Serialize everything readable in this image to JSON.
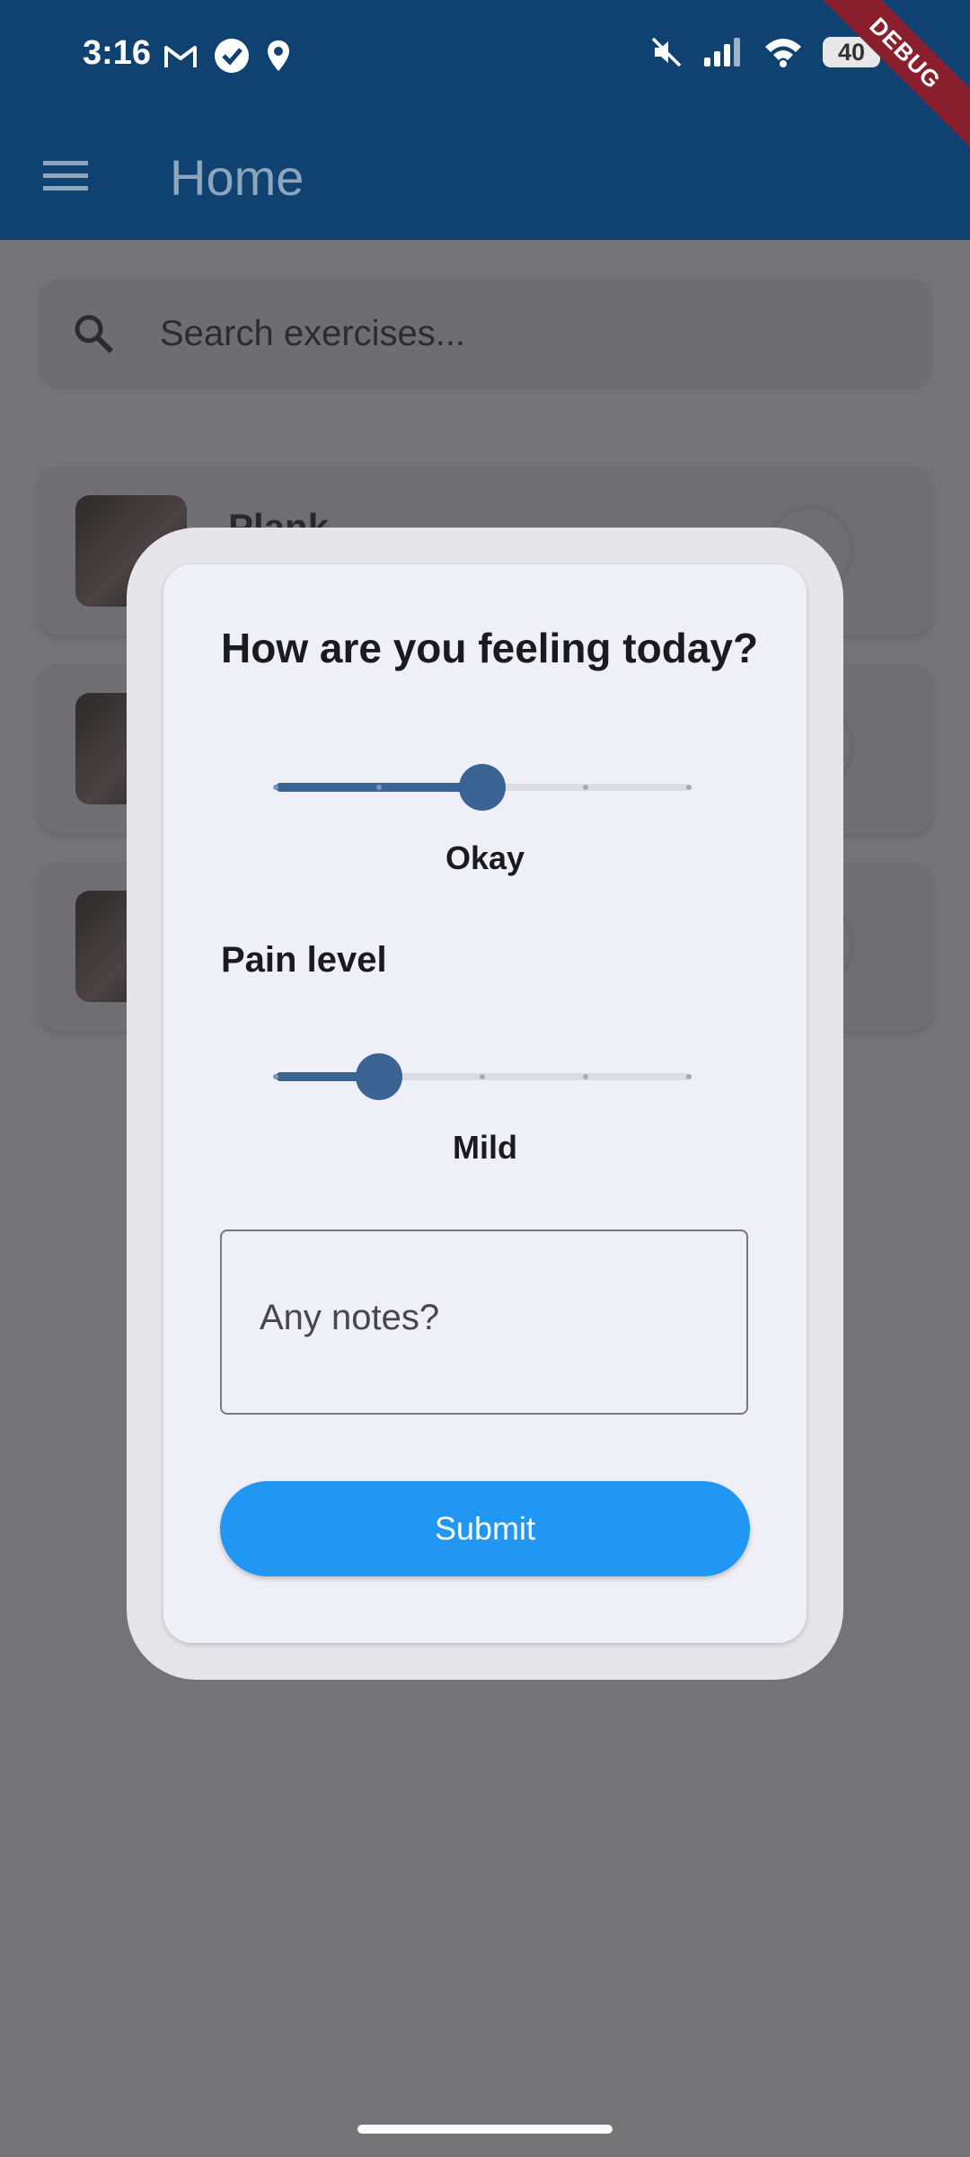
{
  "status_bar": {
    "time": "3:16",
    "battery": "40",
    "left_icons": [
      "gmail-icon",
      "tasks-check-icon",
      "location-icon"
    ],
    "right_icons": [
      "mute-icon",
      "signal-icon",
      "wifi-icon",
      "battery-icon"
    ]
  },
  "debug_banner": "DEBUG",
  "app_bar": {
    "title": "Home",
    "menu_icon": "menu-icon"
  },
  "search": {
    "placeholder": "Search exercises..."
  },
  "exercise_list": [
    {
      "title": "Plank"
    },
    {
      "title": ""
    },
    {
      "title": ""
    }
  ],
  "dialog": {
    "title": "How are you feeling today?",
    "feeling_slider": {
      "value": 2,
      "min": 0,
      "max": 4,
      "label": "Okay"
    },
    "pain_label": "Pain level",
    "pain_slider": {
      "value": 1,
      "min": 0,
      "max": 4,
      "label": "Mild"
    },
    "notes_placeholder": "Any notes?",
    "submit_label": "Submit"
  },
  "colors": {
    "app_bar": "#0f4270",
    "slider_active": "#3b6393",
    "submit_button": "#2196f2",
    "scrim_background": "#747477"
  }
}
